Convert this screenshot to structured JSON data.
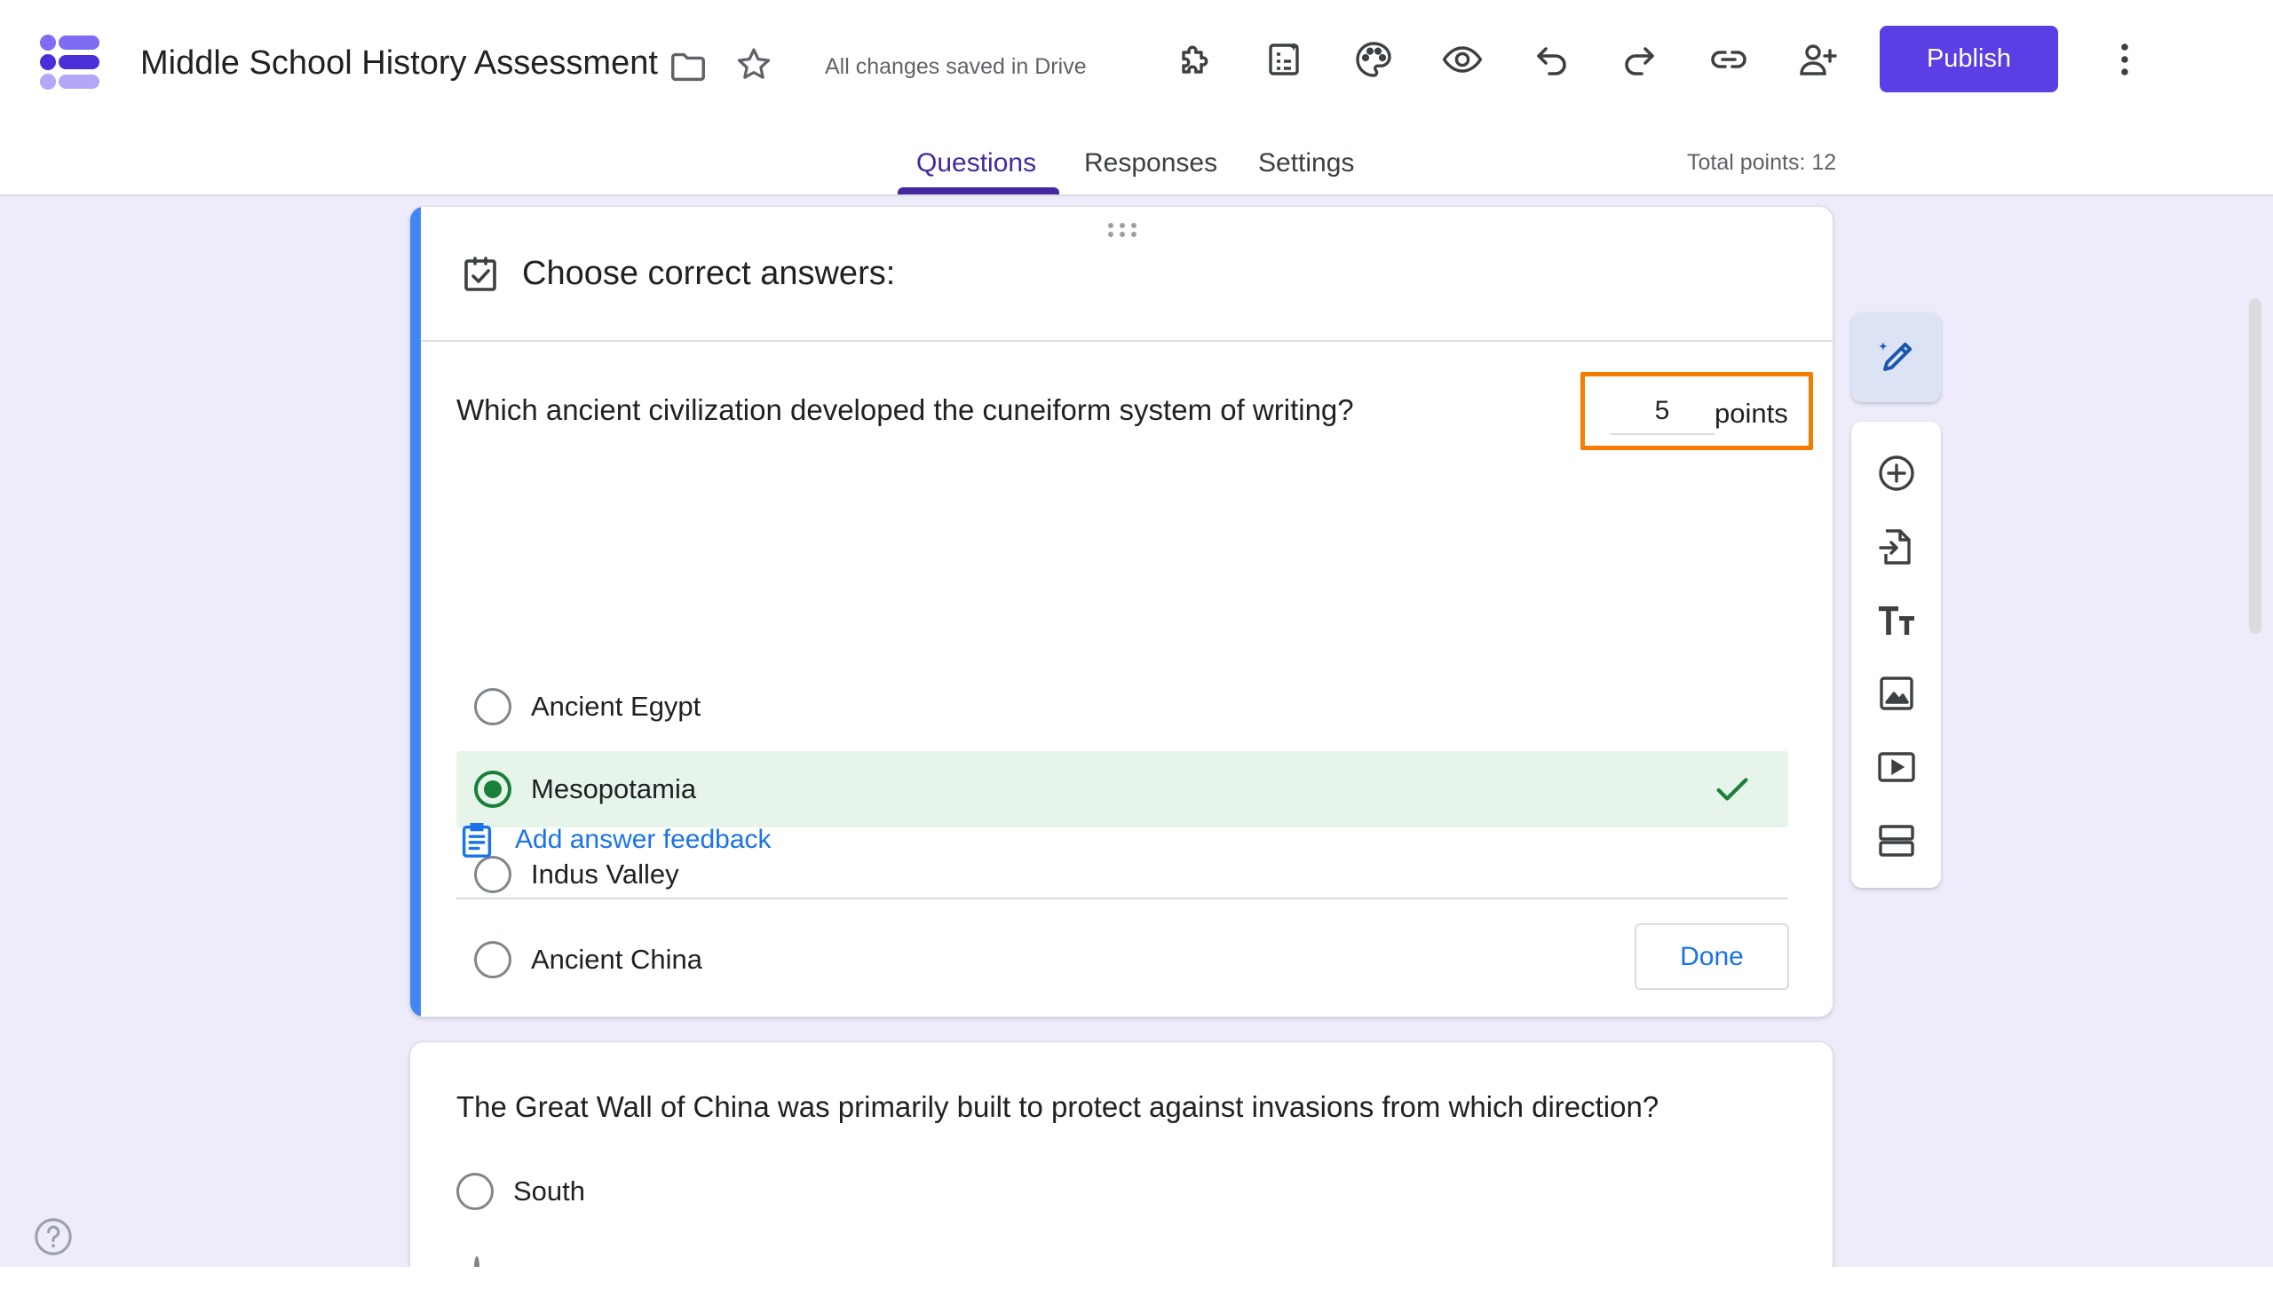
{
  "header": {
    "doc_title": "Middle School History Assessment",
    "save_status": "All changes saved in Drive",
    "publish_label": "Publish",
    "toolbar_icons": [
      "add-ons-icon",
      "ai-form-icon",
      "palette-icon",
      "preview-icon",
      "undo-icon",
      "redo-icon",
      "link-icon",
      "add-collaborator-icon"
    ]
  },
  "tabs": [
    {
      "label": "Questions",
      "active": true
    },
    {
      "label": "Responses",
      "active": false
    },
    {
      "label": "Settings",
      "active": false
    }
  ],
  "total_points": "Total points: 12",
  "question1": {
    "heading": "Choose correct answers:",
    "text": "Which ancient civilization developed the cuneiform system of writing?",
    "points_value": "5",
    "points_label": "points",
    "options": [
      {
        "label": "Ancient Egypt",
        "selected": false
      },
      {
        "label": "Mesopotamia",
        "selected": true
      },
      {
        "label": "Indus Valley",
        "selected": false
      },
      {
        "label": "Ancient China",
        "selected": false
      }
    ],
    "feedback_label": "Add answer feedback",
    "done_label": "Done"
  },
  "question2": {
    "text": "The Great Wall of China was primarily built to protect against invasions from which direction?",
    "options": [
      {
        "label": "South"
      }
    ]
  },
  "side_toolbar": [
    "ai-edit-icon",
    "add-question-icon",
    "import-questions-icon",
    "add-title-icon",
    "add-image-icon",
    "add-video-icon",
    "add-section-icon"
  ],
  "colors": {
    "primary": "#5b3fe4",
    "tab_active": "#4527a0",
    "accent_blue": "#4285f4",
    "correct_green": "#188038",
    "correct_bg": "#e6f4ea",
    "highlight_orange": "#f57c00",
    "background": "#eeecfb"
  }
}
